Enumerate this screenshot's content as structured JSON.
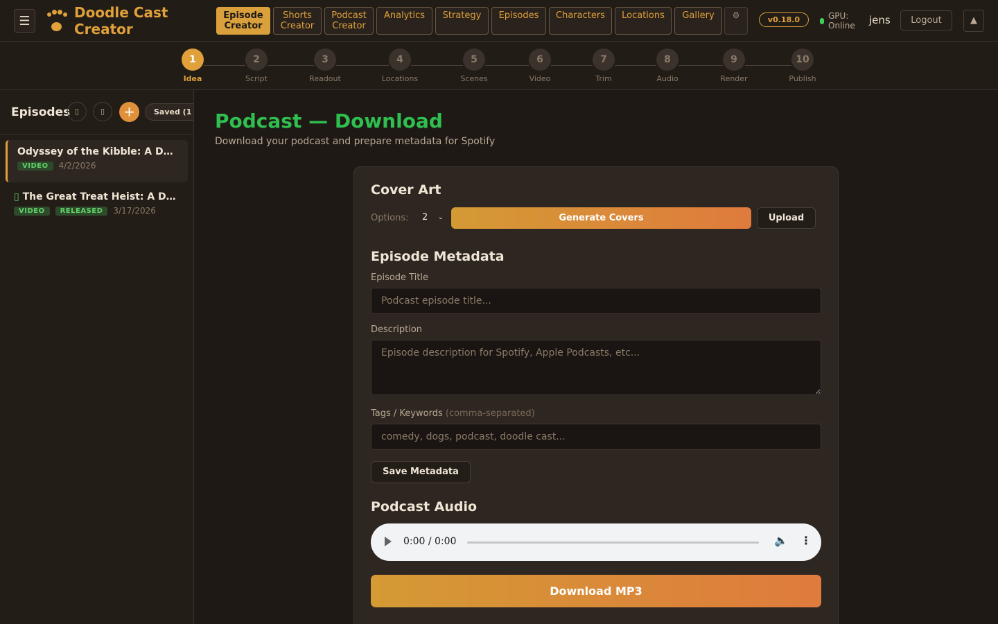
{
  "app": {
    "title_line1": "Doodle Cast",
    "title_line2": "Creator"
  },
  "nav": [
    {
      "label": "Episode\nCreator",
      "active": true
    },
    {
      "label": "Shorts\nCreator"
    },
    {
      "label": "Podcast\nCreator"
    },
    {
      "label": "Analytics"
    },
    {
      "label": "Strategy"
    },
    {
      "label": "Episodes"
    },
    {
      "label": "Characters"
    },
    {
      "label": "Locations"
    },
    {
      "label": "Gallery"
    }
  ],
  "header": {
    "gear_icon": "⚙",
    "version": "v0.18.0",
    "gpu_label": "GPU:",
    "gpu_status": "Online",
    "gpu_color": "#3fcf5a",
    "username": "jens",
    "logout": "Logout",
    "collapse_icon": "▲",
    "menu_icon": "☰"
  },
  "steps": [
    {
      "num": "1",
      "label": "Idea",
      "active": true
    },
    {
      "num": "2",
      "label": "Script"
    },
    {
      "num": "3",
      "label": "Readout"
    },
    {
      "num": "4",
      "label": "Locations"
    },
    {
      "num": "5",
      "label": "Scenes"
    },
    {
      "num": "6",
      "label": "Video"
    },
    {
      "num": "7",
      "label": "Trim"
    },
    {
      "num": "8",
      "label": "Audio"
    },
    {
      "num": "9",
      "label": "Render"
    },
    {
      "num": "10",
      "label": "Publish"
    }
  ],
  "sidebar": {
    "title": "Episodes",
    "icon1": "▯",
    "icon2": "▯",
    "add": "+",
    "saved": "Saved (1",
    "episodes": [
      {
        "title": "Odyssey of the Kibble: A Do...",
        "badges": [
          "VIDEO"
        ],
        "date": "4/2/2026",
        "selected": true,
        "prefix": ""
      },
      {
        "title": "The Great Treat Heist: A D...",
        "badges": [
          "VIDEO",
          "RELEASED"
        ],
        "date": "3/17/2026",
        "selected": false,
        "prefix": "▯"
      }
    ]
  },
  "main": {
    "title": "Podcast — Download",
    "subtitle": "Download your podcast and prepare metadata for Spotify",
    "cover": {
      "heading": "Cover Art",
      "options_label": "Options:",
      "options_value": "2",
      "generate": "Generate Covers",
      "upload": "Upload"
    },
    "metadata": {
      "heading": "Episode Metadata",
      "title_label": "Episode Title",
      "title_placeholder": "Podcast episode title...",
      "desc_label": "Description",
      "desc_placeholder": "Episode description for Spotify, Apple Podcasts, etc...",
      "tags_label": "Tags / Keywords",
      "tags_hint": "(comma-separated)",
      "tags_placeholder": "comedy, dogs, podcast, doodle cast...",
      "save": "Save Metadata"
    },
    "audio": {
      "heading": "Podcast Audio",
      "time": "0:00 / 0:00",
      "progress": 0,
      "download": "Download MP3"
    }
  }
}
